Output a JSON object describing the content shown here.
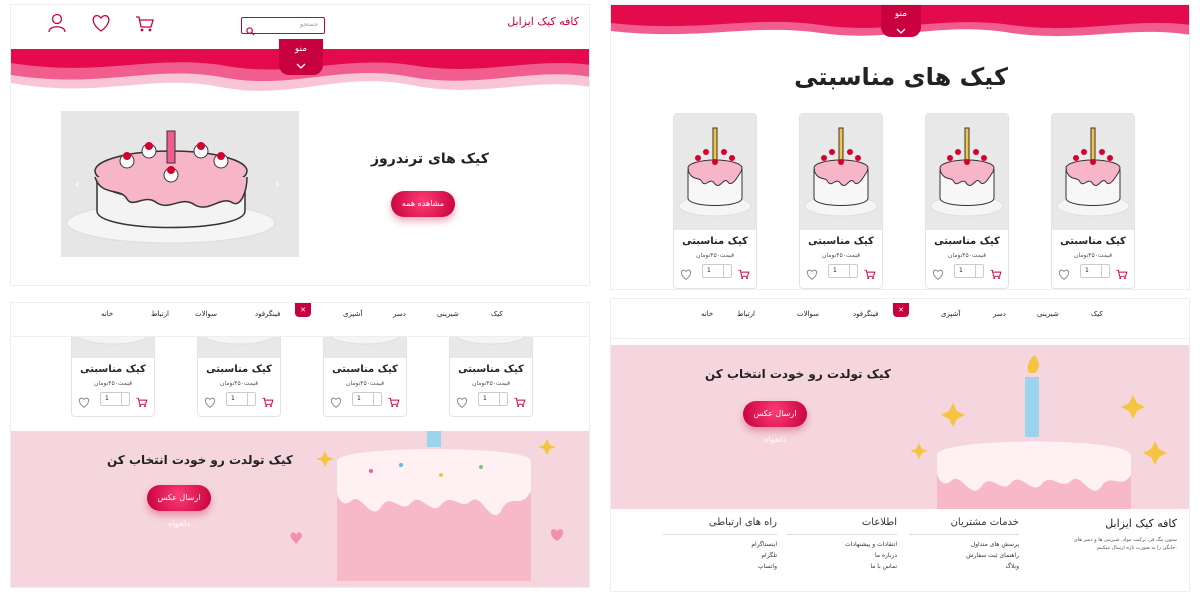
{
  "brand": {
    "name": "کافه کیک ایزابل",
    "accent": "#c8003f"
  },
  "header": {
    "search_placeholder": "جستجو",
    "menu_label": "منو"
  },
  "hero": {
    "title": "کیک های ترندروز",
    "button": "مشاهده همه"
  },
  "nav": {
    "items": [
      "کیک",
      "شیرینی",
      "دسر",
      "آشپزی",
      "فینگرفود",
      "سوالات",
      "ارتباط",
      "خانه"
    ]
  },
  "products_section": {
    "title": "کیک های مناسبتی"
  },
  "product": {
    "name": "کیک مناسبتی",
    "price": "قیمت۴۵۰تومان",
    "qty": "1"
  },
  "birthday": {
    "title": "کیک تولدت رو خودت انتخاب کن",
    "button": "ارسال عکس دلخواه"
  },
  "footer": {
    "brand": "کافه کیک ایزابل",
    "about": "ستون پنگ فر، ترکیب مواد، شیرینی ها و دسر های خانگی را به صورت تازه ارسال میکنیم.",
    "services": {
      "title": "خدمات مشتریان",
      "links": [
        "پرسش های متداول",
        "راهنمای ثبت سفارش",
        "وبلاگ"
      ]
    },
    "info": {
      "title": "اطلاعات",
      "links": [
        "انتقادات و پیشنهادات",
        "درباره ما",
        "تماس با ما"
      ]
    },
    "contact": {
      "title": "راه های ارتباطی",
      "links": [
        "اینستاگرام",
        "تلگرام",
        "واتساپ"
      ]
    }
  },
  "colors": {
    "pink_light": "#f7c5d3",
    "pink_mid": "#f05d8e",
    "pink_dark": "#e30b4c",
    "cake_bg": "#f6d6de"
  }
}
